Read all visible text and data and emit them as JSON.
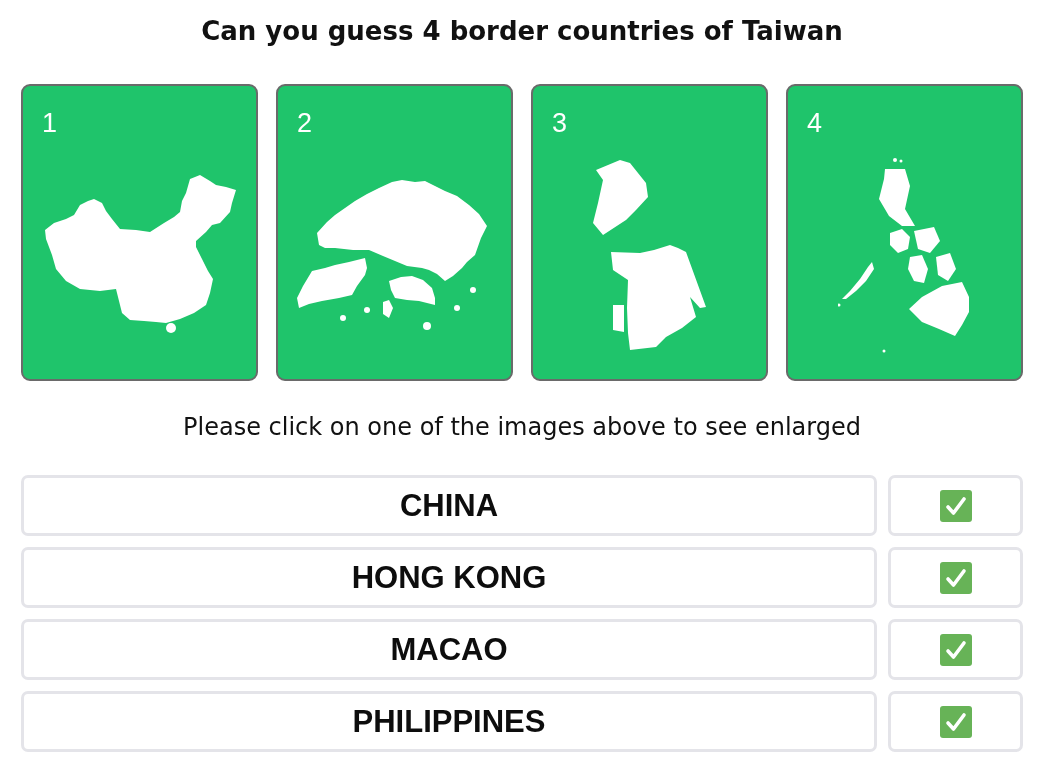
{
  "title": "Can you guess 4 border countries of Taiwan",
  "images": [
    {
      "number": "1"
    },
    {
      "number": "2"
    },
    {
      "number": "3"
    },
    {
      "number": "4"
    }
  ],
  "instruction": "Please click on one of the images above to see enlarged",
  "answers": [
    {
      "label": "CHINA",
      "checked": true
    },
    {
      "label": "HONG KONG",
      "checked": true
    },
    {
      "label": "MACAO",
      "checked": true
    },
    {
      "label": "PHILIPPINES",
      "checked": true
    }
  ]
}
